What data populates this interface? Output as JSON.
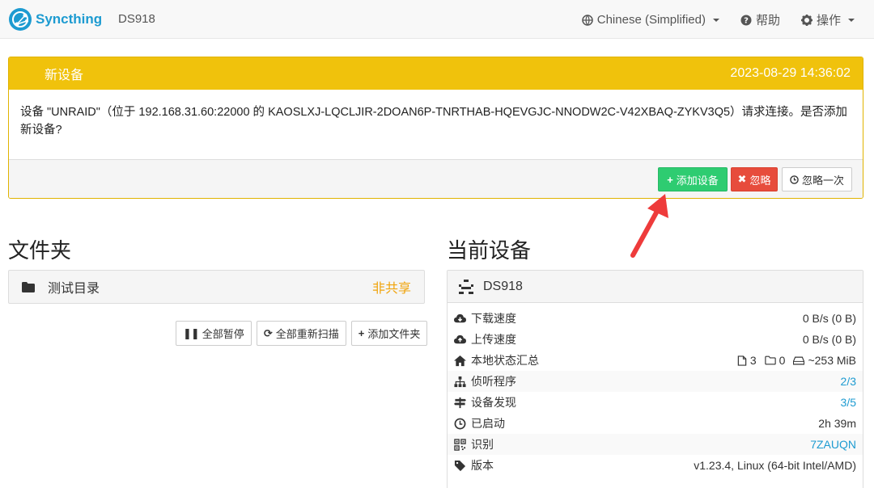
{
  "navbar": {
    "brand": "Syncthing",
    "device": "DS918",
    "language": "Chinese (Simplified)",
    "help": "帮助",
    "actions": "操作"
  },
  "notice": {
    "title": "新设备",
    "time": "2023-08-29 14:36:02",
    "message": "设备 \"UNRAID\"（位于 192.168.31.60:22000 的 KAOSLXJ-LQCLJIR-2DOAN6P-TNRTHAB-HQEVGJC-NNODW2C-V42XBAQ-ZYKV3Q5）请求连接。是否添加新设备?",
    "add_label": "添加设备",
    "ignore_label": "忽略",
    "later_label": "忽略一次"
  },
  "folders": {
    "title": "文件夹",
    "items": [
      {
        "name": "测试目录",
        "state": "非共享"
      }
    ],
    "pause_all": "全部暂停",
    "rescan_all": "全部重新扫描",
    "add_folder": "添加文件夹"
  },
  "device": {
    "title": "当前设备",
    "name": "DS918",
    "rows": [
      {
        "label": "下载速度",
        "value": "0 B/s (0 B)"
      },
      {
        "label": "上传速度",
        "value": "0 B/s (0 B)"
      },
      {
        "label": "本地状态汇总",
        "files": "3",
        "dirs": "0",
        "size": "~253 MiB"
      },
      {
        "label": "侦听程序",
        "value": "2/3"
      },
      {
        "label": "设备发现",
        "value": "3/5"
      },
      {
        "label": "已启动",
        "value": "2h 39m"
      },
      {
        "label": "识别",
        "value": "7ZAUQN"
      },
      {
        "label": "版本",
        "value": "v1.23.4, Linux (64-bit Intel/AMD)"
      }
    ]
  },
  "colors": {
    "brand": "#1d9bd1",
    "warning": "#f0c20c",
    "success": "#2ecc71",
    "danger": "#e74c3c"
  }
}
